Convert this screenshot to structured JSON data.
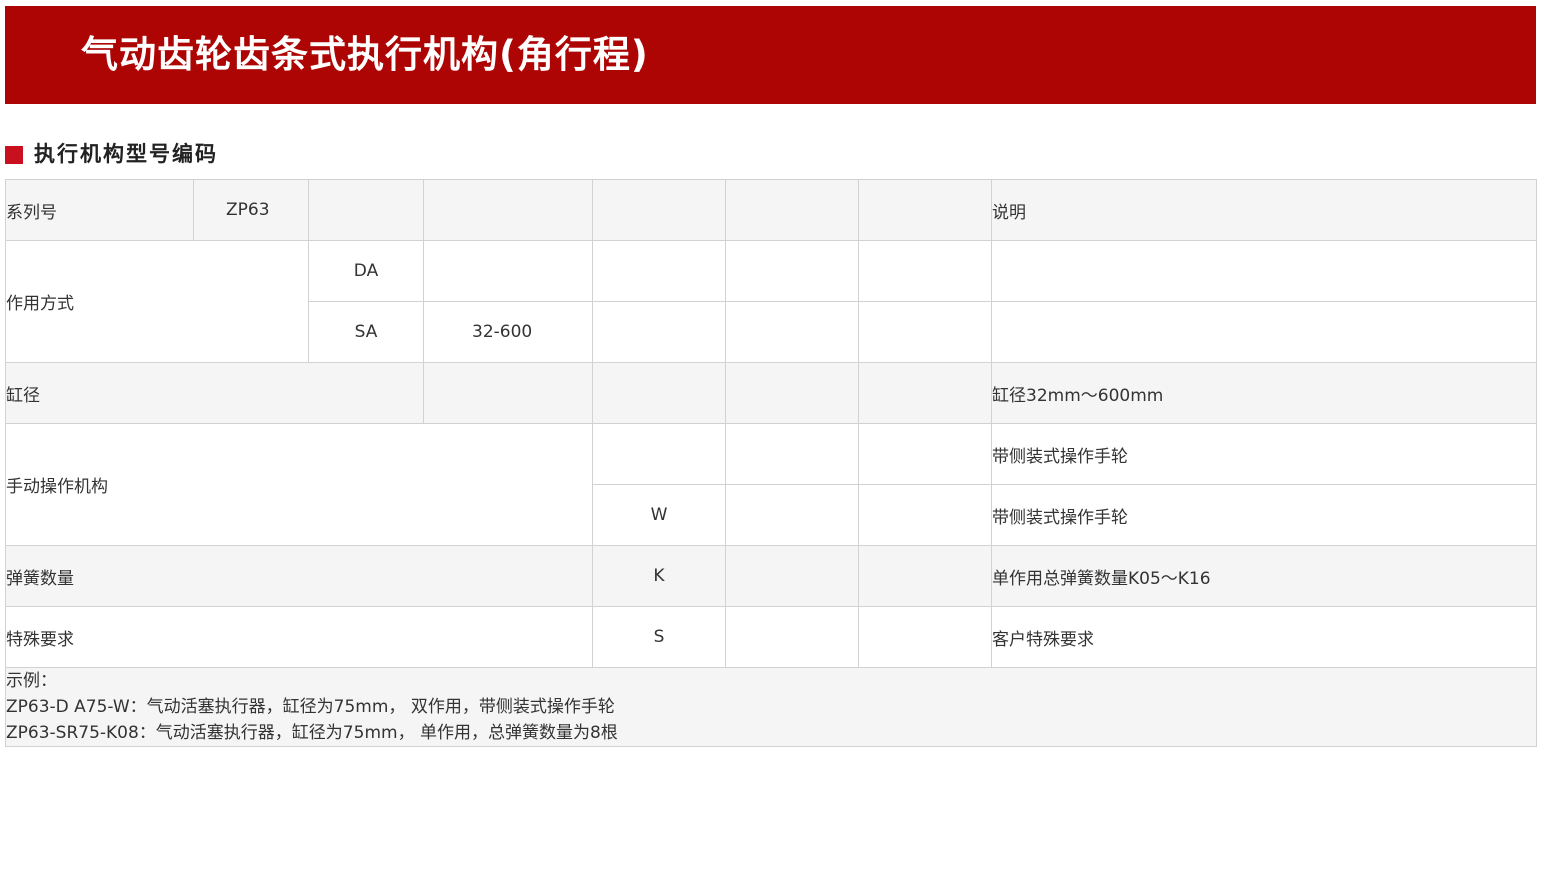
{
  "header": {
    "title": "气动齿轮齿条式执行机构(角行程)"
  },
  "section": {
    "title": "执行机构型号编码"
  },
  "table": {
    "series": {
      "label": "系列号",
      "value": "ZP63",
      "note_header": "说明"
    },
    "action": {
      "label": "作用方式",
      "da": "DA",
      "sa": "SA",
      "range": "32-600"
    },
    "bore": {
      "label": "缸径",
      "note": "缸径32mm～600mm"
    },
    "manual": {
      "label": "手动操作机构",
      "code": "W",
      "note_1": "带侧装式操作手轮",
      "note_2": "带侧装式操作手轮"
    },
    "spring": {
      "label": "弹簧数量",
      "code": "K",
      "note": "单作用总弹簧数量K05～K16"
    },
    "special": {
      "label": "特殊要求",
      "code": "S",
      "note": "客户特殊要求"
    },
    "example": {
      "title": "示例：",
      "line_1": "ZP63-D A75-W：气动活塞执行器，缸径为75mm， 双作用，带侧装式操作手轮",
      "line_2": "ZP63-SR75-K08：气动活塞执行器，缸径为75mm， 单作用，总弹簧数量为8根"
    }
  },
  "colors": {
    "banner": "#ad0404",
    "accent_square": "#c8101e",
    "row_shade": "#f5f5f5",
    "border": "#d2d2d2"
  }
}
